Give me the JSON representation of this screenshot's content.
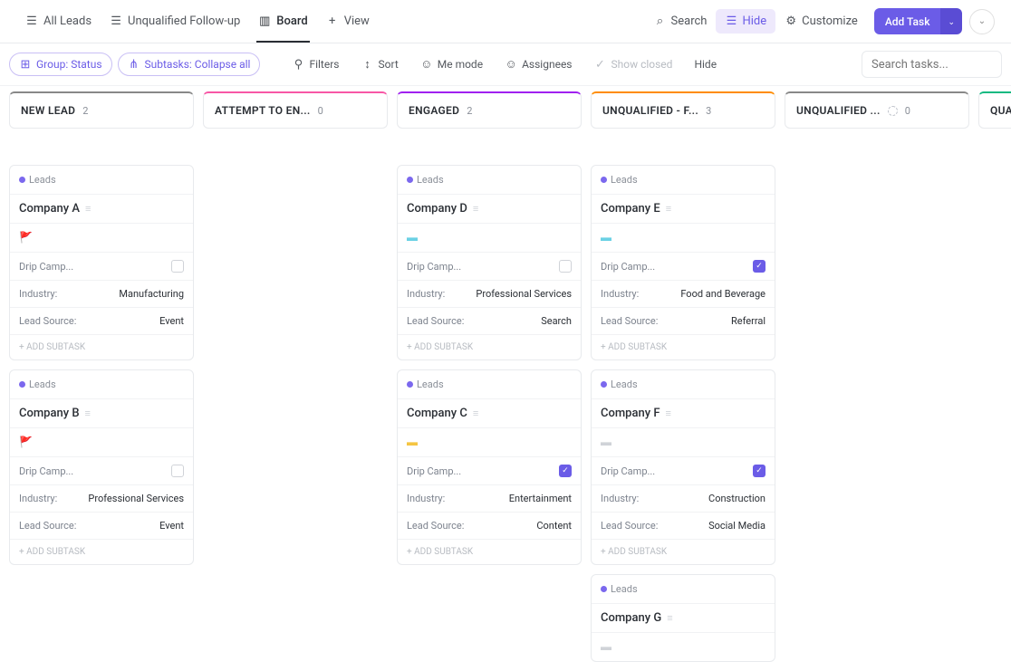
{
  "views": {
    "all": "All Leads",
    "follow": "Unqualified Follow-up",
    "board": "Board",
    "add": "View"
  },
  "top": {
    "search": "Search",
    "hide": "Hide",
    "customize": "Customize",
    "add": "Add Task"
  },
  "toolbar": {
    "group": "Group: Status",
    "subtasks": "Subtasks: Collapse all",
    "filters": "Filters",
    "sort": "Sort",
    "me": "Me mode",
    "assignees": "Assignees",
    "closed": "Show closed",
    "hidebtn": "Hide",
    "search_ph": "Search tasks..."
  },
  "field": {
    "drip": "Drip Camp...",
    "industry": "Industry:",
    "source": "Lead Source:",
    "addsub": "+ ADD SUBTASK",
    "leads": "Leads"
  },
  "cols": [
    {
      "name": "NEW LEAD",
      "count": "2",
      "color": "#888"
    },
    {
      "name": "ATTEMPT TO EN...",
      "count": "0",
      "color": "#f857a6"
    },
    {
      "name": "ENGAGED",
      "count": "2",
      "color": "#a020f0"
    },
    {
      "name": "UNQUALIFIED - F...",
      "count": "3",
      "color": "#ff8c00"
    },
    {
      "name": "UNQUALIFIED ...",
      "count": "0",
      "color": "#888",
      "loading": true
    },
    {
      "name": "QUALIF",
      "count": "",
      "color": "#10b981"
    }
  ],
  "cards": {
    "c0": [
      {
        "t": "Company A",
        "flag": "🚩",
        "flagc": "#e84b3c",
        "drip": false,
        "ind": "Manufacturing",
        "src": "Event"
      },
      {
        "t": "Company B",
        "flag": "🚩",
        "flagc": "#e84b3c",
        "drip": false,
        "ind": "Professional Services",
        "src": "Event"
      }
    ],
    "c2": [
      {
        "t": "Company D",
        "flag": "▬",
        "flagc": "#6bd1e4",
        "drip": false,
        "ind": "Professional Services",
        "src": "Search"
      },
      {
        "t": "Company C",
        "flag": "▬",
        "flagc": "#f5c542",
        "drip": true,
        "ind": "Entertainment",
        "src": "Content"
      }
    ],
    "c3": [
      {
        "t": "Company E",
        "flag": "▬",
        "flagc": "#6bd1e4",
        "drip": true,
        "ind": "Food and Beverage",
        "src": "Referral"
      },
      {
        "t": "Company F",
        "flag": "▬",
        "flagc": "#d0d3d8",
        "drip": true,
        "ind": "Construction",
        "src": "Social Media"
      },
      {
        "t": "Company G",
        "flag": "▬",
        "flagc": "#d0d3d8",
        "partial": true
      }
    ]
  }
}
